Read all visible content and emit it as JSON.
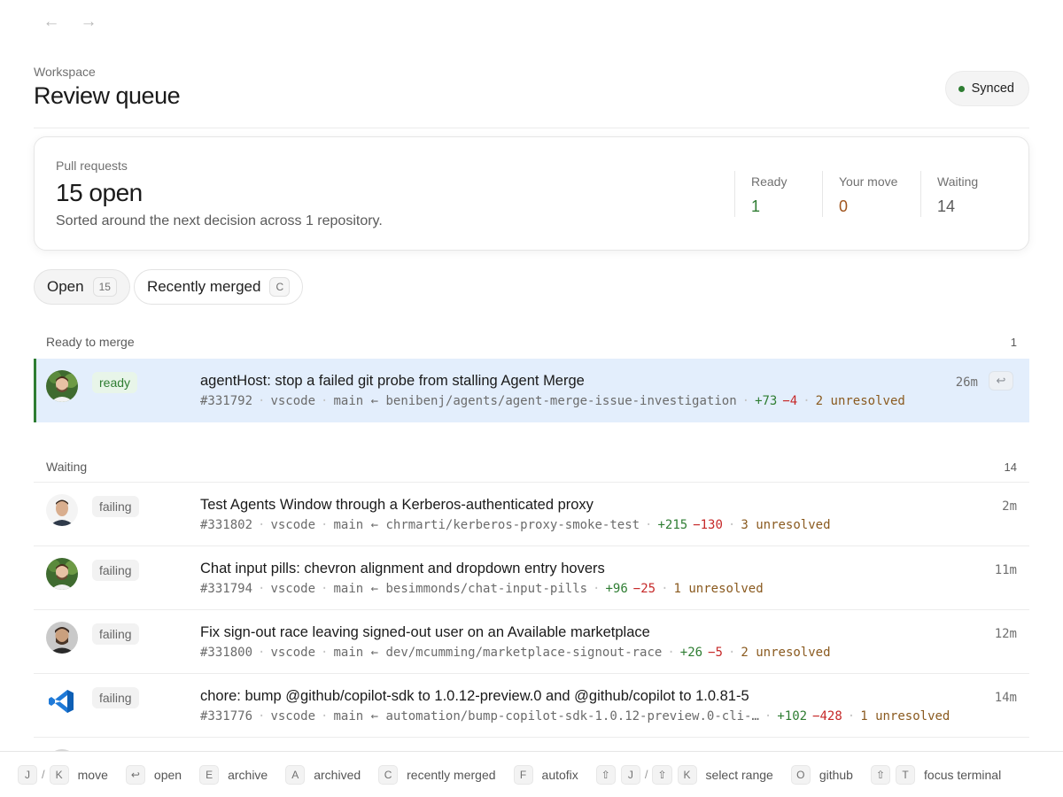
{
  "workspace": {
    "eyebrow": "Workspace",
    "title": "Review queue",
    "sync_label": "Synced"
  },
  "summary": {
    "label": "Pull requests",
    "count": "15 open",
    "description": "Sorted around the next decision across 1 repository.",
    "stats": {
      "ready_label": "Ready",
      "ready_value": "1",
      "move_label": "Your move",
      "move_value": "0",
      "waiting_label": "Waiting",
      "waiting_value": "14"
    }
  },
  "tabs": {
    "open_label": "Open",
    "open_count": "15",
    "merged_label": "Recently merged",
    "merged_key": "C"
  },
  "sections": {
    "ready": {
      "title": "Ready to merge",
      "count": "1",
      "rows": [
        {
          "status": "ready",
          "title": "agentHost: stop a failed git probe from stalling Agent Merge",
          "number": "#331792",
          "repo": "vscode",
          "branch": "main ← benibenj/agents/agent-merge-issue-investigation",
          "add": "+73",
          "del": "−4",
          "unresolved": "2 unresolved",
          "age": "26m",
          "open_key": "↩"
        }
      ]
    },
    "waiting": {
      "title": "Waiting",
      "count": "14",
      "rows": [
        {
          "status": "failing",
          "title": "Test Agents Window through a Kerberos-authenticated proxy",
          "number": "#331802",
          "repo": "vscode",
          "branch": "main ← chrmarti/kerberos-proxy-smoke-test",
          "add": "+215",
          "del": "−130",
          "unresolved": "3 unresolved",
          "age": "2m"
        },
        {
          "status": "failing",
          "title": "Chat input pills: chevron alignment and dropdown entry hovers",
          "number": "#331794",
          "repo": "vscode",
          "branch": "main ← besimmonds/chat-input-pills",
          "add": "+96",
          "del": "−25",
          "unresolved": "1 unresolved",
          "age": "11m"
        },
        {
          "status": "failing",
          "title": "Fix sign-out race leaving signed-out user on an Available marketplace",
          "number": "#331800",
          "repo": "vscode",
          "branch": "main ← dev/mcumming/marketplace-signout-race",
          "add": "+26",
          "del": "−5",
          "unresolved": "2 unresolved",
          "age": "12m"
        },
        {
          "status": "failing",
          "title": "chore: bump @github/copilot-sdk to 1.0.12-preview.0 and @github/copilot to 1.0.81-5",
          "number": "#331776",
          "repo": "vscode",
          "branch": "main ← automation/bump-copilot-sdk-1.0.12-preview.0-cli-…",
          "add": "+102",
          "del": "−428",
          "unresolved": "1 unresolved",
          "age": "14m"
        }
      ]
    }
  },
  "shortcuts": {
    "j": "J",
    "k": "K",
    "move": "move",
    "enter": "↩",
    "open": "open",
    "e": "E",
    "archive": "archive",
    "a": "A",
    "archived": "archived",
    "c": "C",
    "recently_merged": "recently merged",
    "f": "F",
    "autofix": "autofix",
    "shift": "⇧",
    "select_range": "select range",
    "o": "O",
    "github": "github",
    "t": "T",
    "focus_terminal": "focus terminal",
    "slash": "/"
  },
  "colors": {
    "ready": "#2e7d32",
    "your_move": "#a0551e",
    "selected_row": "#e3eefc",
    "additions": "#2e7d32",
    "deletions": "#c62828",
    "unresolved": "#8a5a1f"
  }
}
